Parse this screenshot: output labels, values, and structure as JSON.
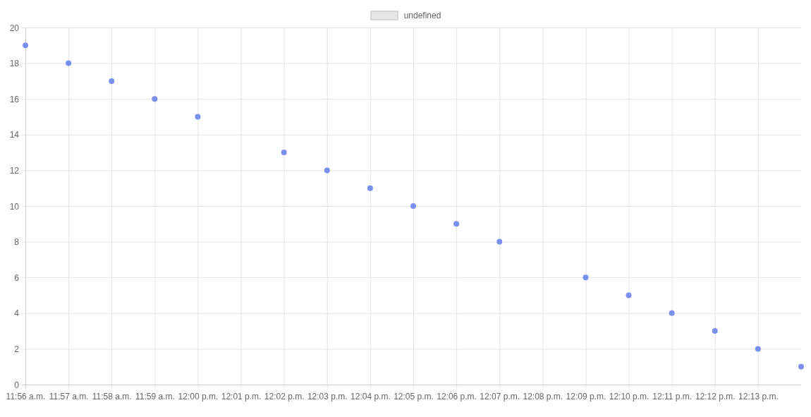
{
  "legend": {
    "color": "#e6e6e6"
  },
  "chart_data": {
    "type": "scatter",
    "categories": [
      "11:56 a.m.",
      "11:57 a.m.",
      "11:58 a.m.",
      "11:59 a.m.",
      "12:00 p.m.",
      "12:01 p.m.",
      "12:02 p.m.",
      "12:03 p.m.",
      "12:04 p.m.",
      "12:05 p.m.",
      "12:06 p.m.",
      "12:07 p.m.",
      "12:08 p.m.",
      "12:09 p.m.",
      "12:10 p.m.",
      "12:11 p.m.",
      "12:12 p.m.",
      "12:13 p.m.",
      null
    ],
    "series": [
      {
        "name": "undefined",
        "color": "#7b8fef",
        "values": [
          19,
          18,
          17,
          16,
          15,
          null,
          13,
          12,
          11,
          10,
          9,
          8,
          null,
          6,
          5,
          4,
          3,
          2,
          1
        ]
      }
    ],
    "ylim": [
      0,
      20
    ],
    "grid": true,
    "yticks": [
      0,
      2,
      4,
      6,
      8,
      10,
      12,
      14,
      16,
      18,
      20
    ]
  }
}
